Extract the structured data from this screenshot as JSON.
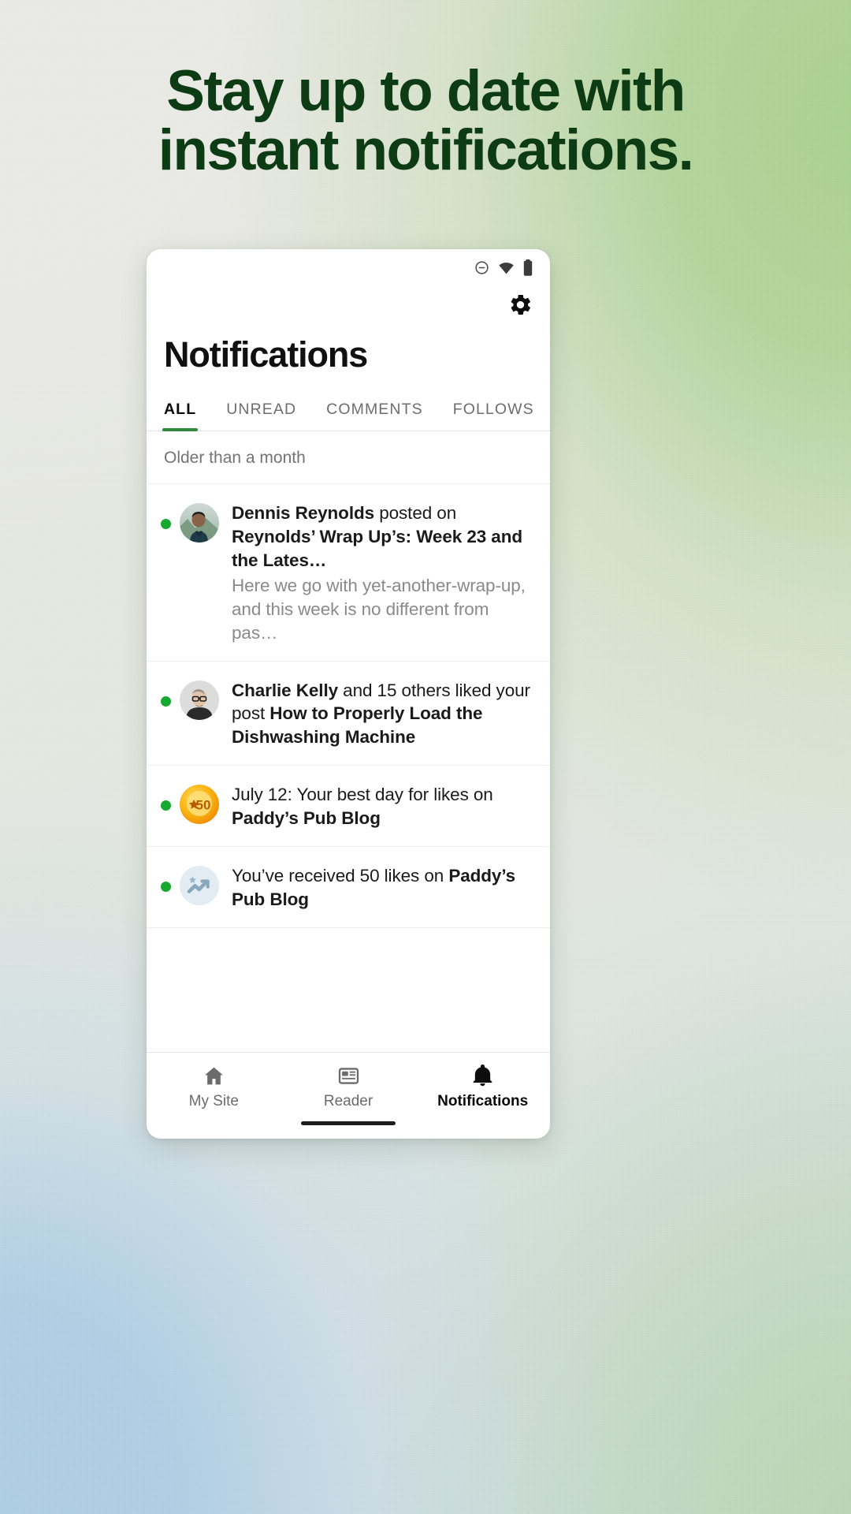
{
  "headline": {
    "line1": "Stay up to date with",
    "line2": "instant notifications.",
    "color": "#0d3b14"
  },
  "phone": {
    "status_bar": {
      "icons": [
        "do-not-disturb-icon",
        "wifi-icon",
        "battery-icon"
      ]
    },
    "settings_button_label": "gear-icon",
    "screen_title": "Notifications",
    "tabs": [
      {
        "label": "ALL",
        "active": true
      },
      {
        "label": "UNREAD",
        "active": false
      },
      {
        "label": "COMMENTS",
        "active": false
      },
      {
        "label": "FOLLOWS",
        "active": false
      }
    ],
    "active_tab_color": "#2f8a3e",
    "section_header": "Older than a month",
    "notifications": [
      {
        "unread": true,
        "icon": "avatar-photo-dennis",
        "line_parts": [
          {
            "text": "Dennis Reynolds",
            "bold": true
          },
          {
            "text": " posted on ",
            "bold": false
          },
          {
            "text": "Reynolds’ Wrap Up’s: Week 23 and the Lates…",
            "bold": true
          }
        ],
        "snippet": "Here we go with yet-another-wrap-up, and this week is no different from pas…"
      },
      {
        "unread": true,
        "icon": "avatar-photo-charlie",
        "line_parts": [
          {
            "text": "Charlie Kelly",
            "bold": true
          },
          {
            "text": " and 15 others liked your post ",
            "bold": false
          },
          {
            "text": "How to Properly Load the Dishwashing Machine",
            "bold": true
          }
        ],
        "snippet": ""
      },
      {
        "unread": true,
        "icon": "milestone-badge-50-icon",
        "badge_value": "50",
        "line_parts": [
          {
            "text": "July 12: Your best day for likes on ",
            "bold": false
          },
          {
            "text": "Paddy’s Pub Blog",
            "bold": true
          }
        ],
        "snippet": ""
      },
      {
        "unread": true,
        "icon": "trending-up-icon",
        "line_parts": [
          {
            "text": "You’ve received 50 likes on ",
            "bold": false
          },
          {
            "text": "Paddy’s Pub Blog",
            "bold": true
          }
        ],
        "snippet": ""
      }
    ],
    "bottom_nav": [
      {
        "label": "My Site",
        "icon": "home-icon",
        "active": false
      },
      {
        "label": "Reader",
        "icon": "reader-icon",
        "active": false
      },
      {
        "label": "Notifications",
        "icon": "bell-icon",
        "active": true
      }
    ]
  },
  "colors": {
    "unread_dot": "#16a830",
    "tab_underline": "#2f8a3e",
    "badge_orange": "#f5a623",
    "headline_green": "#0d3b14"
  }
}
